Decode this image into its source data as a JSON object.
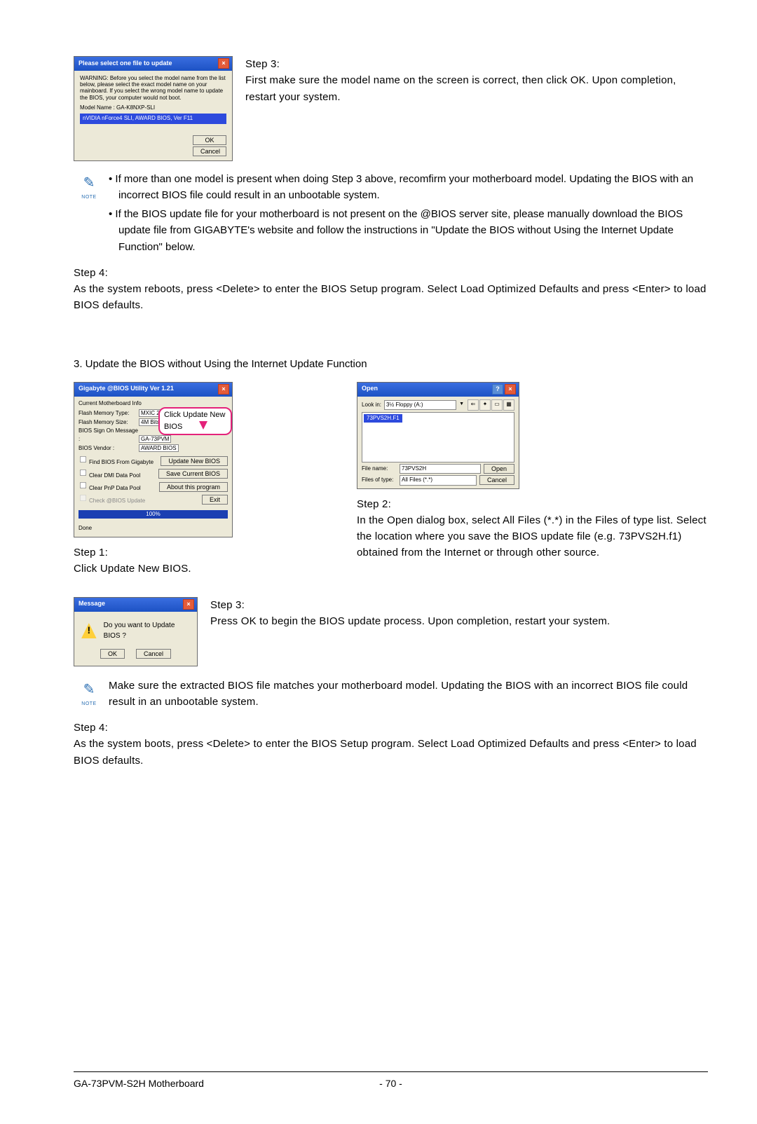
{
  "dialog1": {
    "title": "Please select one file to update",
    "warning": "WARNING: Before you select the model name from the list below, please select the exact model name on your mainboard. If you select the wrong model name to update the BIOS, your computer would not boot.",
    "model_label": "Model Name : GA-K8NXP-SLI",
    "selected": "nVIDIA nForce4 SLI, AWARD BIOS, Ver F11",
    "ok": "OK",
    "cancel": "Cancel"
  },
  "step3a": {
    "label": "Step 3:",
    "text": "First make sure the model name on the screen is correct, then click OK. Upon completion, restart your system."
  },
  "note1": {
    "label": "NOTE",
    "bullet1": "If more than one model is present when doing Step 3 above, recomfirm your motherboard model. Updating the BIOS with an incorrect BIOS file could result in an unbootable system.",
    "bullet2": "If the BIOS update file for your motherboard is not present on the @BIOS server site, please manually download the BIOS update file from GIGABYTE's website and follow the instructions in \"Update the BIOS without Using the Internet Update Function\" below."
  },
  "step4a": {
    "label": "Step 4:",
    "text": "As the system reboots, press <Delete> to enter the BIOS Setup program. Select Load Optimized Defaults and press <Enter> to load BIOS defaults."
  },
  "section3": "3.   Update the BIOS without Using the Internet Update Function",
  "dialog2": {
    "title": "Gigabyte @BIOS Utility Ver 1.21",
    "group": "Current Motherboard Info",
    "flash_type_l": "Flash Memory Type:",
    "flash_type_v": "MXIC 25L4005",
    "flash_size_l": "Flash Memory Size:",
    "flash_size_v": "4M Bits (x)",
    "sign_l": "BIOS Sign On Message :",
    "sign_v": "GA-73PVM",
    "vendor_l": "BIOS Vendor :",
    "vendor_v": "AWARD BIOS",
    "chk1": "Find BIOS From Gigabyte",
    "btn1": "Update New BIOS",
    "chk2": "Clear DMI Data Pool",
    "btn2": "Save Current BIOS",
    "chk3": "Clear PnP Data Pool",
    "btn3": "About this program",
    "chk4": "Check @BIOS Update",
    "btn4": "Exit",
    "progress": "100%",
    "done": "Done",
    "callout": "Click Update New BIOS"
  },
  "step1b": {
    "label": "Step 1:",
    "text": "Click Update New BIOS."
  },
  "dialog3": {
    "title": "Open",
    "lookin_l": "Look in:",
    "lookin_v": "3½ Floppy (A:)",
    "file_sel": "73PVS2H.F1",
    "filename_l": "File name:",
    "filename_v": "73PVS2H",
    "type_l": "Files of type:",
    "type_v": "All Files (*.*)",
    "open": "Open",
    "cancel": "Cancel"
  },
  "step2b": {
    "label": "Step 2:",
    "text": "In the Open dialog box, select  All Files (*.*) in the Files of type list. Select the location where you save the BIOS update file (e.g. 73PVS2H.f1) obtained from the Internet or through other source."
  },
  "dialog4": {
    "title": "Message",
    "msg": "Do you want to Update BIOS ?",
    "ok": "OK",
    "cancel": "Cancel"
  },
  "step3b": {
    "label": "Step 3:",
    "text": "Press OK to begin the BIOS update process. Upon completion, restart your system."
  },
  "note2": {
    "label": "NOTE",
    "text": "Make sure the extracted BIOS file matches your motherboard model. Updating the BIOS with an incorrect BIOS file could result in an unbootable system."
  },
  "step4b": {
    "label": "Step 4:",
    "text": "As the system boots, press <Delete> to enter the BIOS Setup program. Select Load Optimized Defaults and press <Enter> to load BIOS defaults."
  },
  "footer": {
    "left": "GA-73PVM-S2H Motherboard",
    "center": "- 70 -"
  }
}
